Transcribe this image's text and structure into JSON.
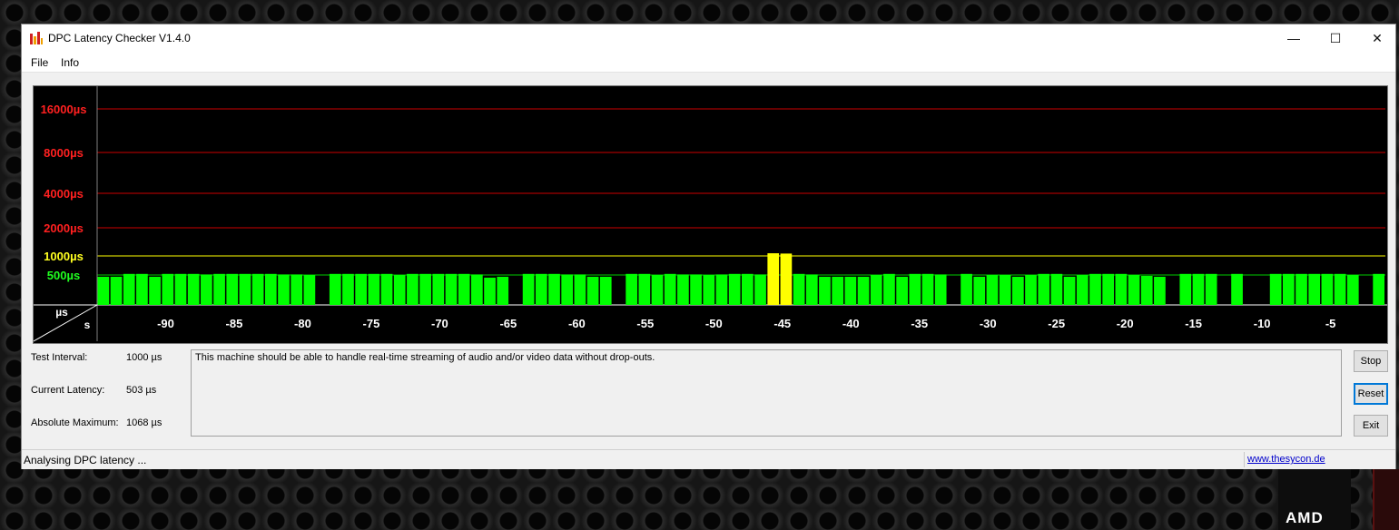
{
  "window": {
    "title": "DPC Latency Checker V1.4.0",
    "controls": {
      "minimize": "—",
      "maximize": "☐",
      "close": "✕"
    }
  },
  "menu": {
    "items": [
      "File",
      "Info"
    ]
  },
  "chart_data": {
    "type": "bar",
    "y_axis": {
      "unit_label": "µs",
      "scale": "log2",
      "ticks": [
        {
          "label": "16000µs",
          "value": 16000,
          "color": "#ff2020"
        },
        {
          "label": "8000µs",
          "value": 8000,
          "color": "#ff2020"
        },
        {
          "label": "4000µs",
          "value": 4000,
          "color": "#ff2020"
        },
        {
          "label": "2000µs",
          "value": 2000,
          "color": "#ff2020"
        },
        {
          "label": "1000µs",
          "value": 1000,
          "color": "#ffff20"
        },
        {
          "label": "500µs",
          "value": 500,
          "color": "#20ff20"
        }
      ]
    },
    "x_axis": {
      "unit_label": "s",
      "ticks": [
        "-90",
        "-85",
        "-80",
        "-75",
        "-70",
        "-65",
        "-60",
        "-55",
        "-50",
        "-45",
        "-40",
        "-35",
        "-30",
        "-25",
        "-20",
        "-15",
        "-10",
        "-5"
      ],
      "tick_values": [
        -90,
        -85,
        -80,
        -75,
        -70,
        -65,
        -60,
        -55,
        -50,
        -45,
        -40,
        -35,
        -30,
        -25,
        -20,
        -15,
        -10,
        -5
      ],
      "range": [
        -95,
        -1
      ]
    },
    "colors": {
      "normal": "#00ff00",
      "warning": "#ffff00",
      "grid_red": "#cc0000",
      "grid_yellow": "#ffff00",
      "grid_green": "#00cc00"
    },
    "threshold_warning": 1000,
    "values": [
      480,
      480,
      520,
      520,
      480,
      520,
      520,
      520,
      510,
      520,
      520,
      520,
      520,
      520,
      510,
      510,
      500,
      200,
      520,
      520,
      520,
      520,
      520,
      500,
      520,
      520,
      520,
      520,
      520,
      510,
      470,
      480,
      200,
      520,
      520,
      520,
      510,
      510,
      480,
      480,
      200,
      520,
      520,
      500,
      520,
      510,
      510,
      500,
      510,
      520,
      520,
      510,
      1068,
      1060,
      520,
      510,
      480,
      480,
      480,
      480,
      500,
      520,
      480,
      520,
      520,
      510,
      200,
      520,
      480,
      500,
      500,
      480,
      500,
      520,
      520,
      480,
      500,
      520,
      520,
      520,
      500,
      490,
      480,
      200,
      520,
      520,
      520,
      200,
      520,
      200,
      200,
      520,
      520,
      520,
      520,
      520,
      520,
      500,
      200,
      520
    ]
  },
  "stats": {
    "test_interval": {
      "label": "Test Interval:",
      "value": "1000 µs"
    },
    "current_latency": {
      "label": "Current Latency:",
      "value": "503 µs"
    },
    "absolute_maximum": {
      "label": "Absolute Maximum:",
      "value": "1068 µs"
    }
  },
  "message": "This machine should be able to handle real-time streaming of audio and/or video data without drop-outs.",
  "buttons": {
    "stop": "Stop",
    "reset": "Reset",
    "exit": "Exit"
  },
  "status": {
    "text": "Analysing DPC latency ...",
    "link": "www.thesycon.de"
  },
  "desktop": {
    "logo": "AMD"
  }
}
